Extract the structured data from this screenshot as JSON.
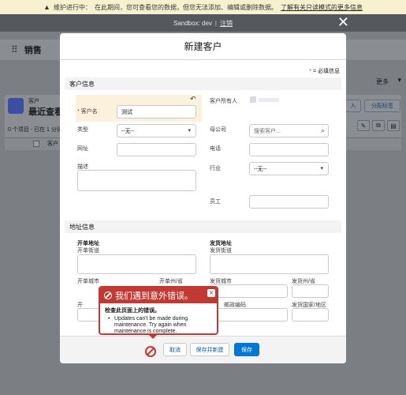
{
  "banner": {
    "prefix": "维护进行中：",
    "message": "在此期间，您可查看您的数据，但您无法添加、编辑或删除数据。",
    "link": "了解有关只读模式的更多信息"
  },
  "sandbox": {
    "label": "Sandbox: dev",
    "separator": "|",
    "logout": "注销"
  },
  "background": {
    "app_name": "销售",
    "more": "更多",
    "object_label": "客户",
    "list_title": "最近查看",
    "status": "0 个项目 - 已在 1 分钟",
    "column": "客户",
    "btn_import": "入",
    "btn_assign": "分配标签"
  },
  "modal": {
    "title": "新建客户",
    "required_note": "= 必填信息",
    "section_customer": "客户信息",
    "fields": {
      "name_label": "客户名",
      "name_value": "测试",
      "owner_label": "客户所有人",
      "type_label": "类型",
      "type_value": "--无--",
      "parent_label": "母公司",
      "parent_placeholder": "搜索客户...",
      "website_label": "网址",
      "phone_label": "电话",
      "description_label": "描述",
      "industry_label": "行业",
      "industry_value": "--无--",
      "employees_label": "员工"
    },
    "section_address": "地址信息",
    "address": {
      "billing_head": "开单地址",
      "billing_street": "开单街道",
      "billing_city": "开单城市",
      "billing_state": "开单州/省",
      "billing_country_initial": "开",
      "shipping_head": "发货地址",
      "shipping_street": "发货街道",
      "shipping_city": "发货城市",
      "shipping_state": "发货州/省",
      "shipping_zip": "邮政编码",
      "shipping_country": "发货国家/地区"
    },
    "footer": {
      "cancel": "取消",
      "save_new": "保存并新建",
      "save": "保存"
    }
  },
  "error": {
    "title": "我们遇到意外错误。",
    "subtitle": "检查此页面上的错误。",
    "message": "Updates can't be made during maintenance. Try again when maintenance is complete.",
    "close": "×"
  },
  "icons": {
    "warning": "warning-icon",
    "close": "close-icon",
    "apps": "app-launcher-icon",
    "search": "search-icon",
    "undo": "undo-icon",
    "error": "error-icon"
  },
  "colors": {
    "brand": "#0176d3",
    "error": "#c23934",
    "banner": "#f7f1cf"
  }
}
